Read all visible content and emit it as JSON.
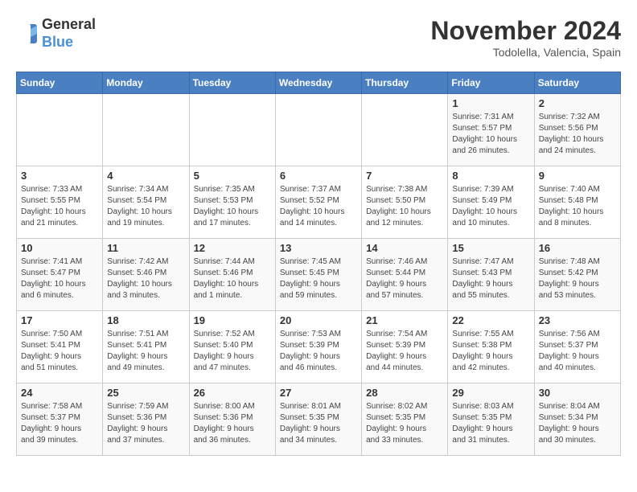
{
  "header": {
    "logo_general": "General",
    "logo_blue": "Blue",
    "month_title": "November 2024",
    "location": "Todolella, Valencia, Spain"
  },
  "weekdays": [
    "Sunday",
    "Monday",
    "Tuesday",
    "Wednesday",
    "Thursday",
    "Friday",
    "Saturday"
  ],
  "weeks": [
    [
      {
        "day": "",
        "info": ""
      },
      {
        "day": "",
        "info": ""
      },
      {
        "day": "",
        "info": ""
      },
      {
        "day": "",
        "info": ""
      },
      {
        "day": "",
        "info": ""
      },
      {
        "day": "1",
        "info": "Sunrise: 7:31 AM\nSunset: 5:57 PM\nDaylight: 10 hours\nand 26 minutes."
      },
      {
        "day": "2",
        "info": "Sunrise: 7:32 AM\nSunset: 5:56 PM\nDaylight: 10 hours\nand 24 minutes."
      }
    ],
    [
      {
        "day": "3",
        "info": "Sunrise: 7:33 AM\nSunset: 5:55 PM\nDaylight: 10 hours\nand 21 minutes."
      },
      {
        "day": "4",
        "info": "Sunrise: 7:34 AM\nSunset: 5:54 PM\nDaylight: 10 hours\nand 19 minutes."
      },
      {
        "day": "5",
        "info": "Sunrise: 7:35 AM\nSunset: 5:53 PM\nDaylight: 10 hours\nand 17 minutes."
      },
      {
        "day": "6",
        "info": "Sunrise: 7:37 AM\nSunset: 5:52 PM\nDaylight: 10 hours\nand 14 minutes."
      },
      {
        "day": "7",
        "info": "Sunrise: 7:38 AM\nSunset: 5:50 PM\nDaylight: 10 hours\nand 12 minutes."
      },
      {
        "day": "8",
        "info": "Sunrise: 7:39 AM\nSunset: 5:49 PM\nDaylight: 10 hours\nand 10 minutes."
      },
      {
        "day": "9",
        "info": "Sunrise: 7:40 AM\nSunset: 5:48 PM\nDaylight: 10 hours\nand 8 minutes."
      }
    ],
    [
      {
        "day": "10",
        "info": "Sunrise: 7:41 AM\nSunset: 5:47 PM\nDaylight: 10 hours\nand 6 minutes."
      },
      {
        "day": "11",
        "info": "Sunrise: 7:42 AM\nSunset: 5:46 PM\nDaylight: 10 hours\nand 3 minutes."
      },
      {
        "day": "12",
        "info": "Sunrise: 7:44 AM\nSunset: 5:46 PM\nDaylight: 10 hours\nand 1 minute."
      },
      {
        "day": "13",
        "info": "Sunrise: 7:45 AM\nSunset: 5:45 PM\nDaylight: 9 hours\nand 59 minutes."
      },
      {
        "day": "14",
        "info": "Sunrise: 7:46 AM\nSunset: 5:44 PM\nDaylight: 9 hours\nand 57 minutes."
      },
      {
        "day": "15",
        "info": "Sunrise: 7:47 AM\nSunset: 5:43 PM\nDaylight: 9 hours\nand 55 minutes."
      },
      {
        "day": "16",
        "info": "Sunrise: 7:48 AM\nSunset: 5:42 PM\nDaylight: 9 hours\nand 53 minutes."
      }
    ],
    [
      {
        "day": "17",
        "info": "Sunrise: 7:50 AM\nSunset: 5:41 PM\nDaylight: 9 hours\nand 51 minutes."
      },
      {
        "day": "18",
        "info": "Sunrise: 7:51 AM\nSunset: 5:41 PM\nDaylight: 9 hours\nand 49 minutes."
      },
      {
        "day": "19",
        "info": "Sunrise: 7:52 AM\nSunset: 5:40 PM\nDaylight: 9 hours\nand 47 minutes."
      },
      {
        "day": "20",
        "info": "Sunrise: 7:53 AM\nSunset: 5:39 PM\nDaylight: 9 hours\nand 46 minutes."
      },
      {
        "day": "21",
        "info": "Sunrise: 7:54 AM\nSunset: 5:39 PM\nDaylight: 9 hours\nand 44 minutes."
      },
      {
        "day": "22",
        "info": "Sunrise: 7:55 AM\nSunset: 5:38 PM\nDaylight: 9 hours\nand 42 minutes."
      },
      {
        "day": "23",
        "info": "Sunrise: 7:56 AM\nSunset: 5:37 PM\nDaylight: 9 hours\nand 40 minutes."
      }
    ],
    [
      {
        "day": "24",
        "info": "Sunrise: 7:58 AM\nSunset: 5:37 PM\nDaylight: 9 hours\nand 39 minutes."
      },
      {
        "day": "25",
        "info": "Sunrise: 7:59 AM\nSunset: 5:36 PM\nDaylight: 9 hours\nand 37 minutes."
      },
      {
        "day": "26",
        "info": "Sunrise: 8:00 AM\nSunset: 5:36 PM\nDaylight: 9 hours\nand 36 minutes."
      },
      {
        "day": "27",
        "info": "Sunrise: 8:01 AM\nSunset: 5:35 PM\nDaylight: 9 hours\nand 34 minutes."
      },
      {
        "day": "28",
        "info": "Sunrise: 8:02 AM\nSunset: 5:35 PM\nDaylight: 9 hours\nand 33 minutes."
      },
      {
        "day": "29",
        "info": "Sunrise: 8:03 AM\nSunset: 5:35 PM\nDaylight: 9 hours\nand 31 minutes."
      },
      {
        "day": "30",
        "info": "Sunrise: 8:04 AM\nSunset: 5:34 PM\nDaylight: 9 hours\nand 30 minutes."
      }
    ]
  ]
}
